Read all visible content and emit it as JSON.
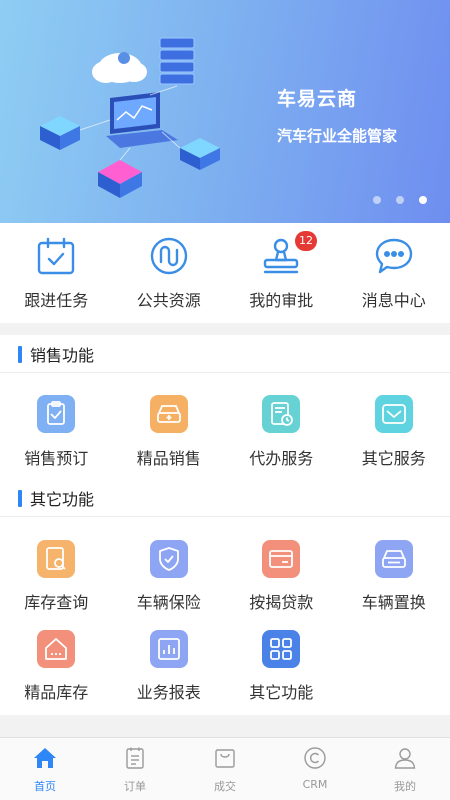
{
  "banner": {
    "title": "车易云商",
    "subtitle": "汽车行业全能管家",
    "dot_count": 3,
    "active_dot": 3
  },
  "quick_actions": [
    {
      "label": "跟进任务",
      "icon": "calendar-check-icon"
    },
    {
      "label": "公共资源",
      "icon": "route-circle-icon"
    },
    {
      "label": "我的审批",
      "icon": "stamp-icon",
      "badge": "12"
    },
    {
      "label": "消息中心",
      "icon": "chat-bubble-icon"
    }
  ],
  "sales": {
    "title": "销售功能",
    "items": [
      {
        "label": "销售预订",
        "icon": "clipboard-check-icon",
        "color": "#7fb0f4"
      },
      {
        "label": "精品销售",
        "icon": "car-plus-icon",
        "color": "#f5b064"
      },
      {
        "label": "代办服务",
        "icon": "document-clock-icon",
        "color": "#67d2d4"
      },
      {
        "label": "其它服务",
        "icon": "diamond-icon",
        "color": "#5fd3df"
      }
    ]
  },
  "other": {
    "title": "其它功能",
    "items": [
      {
        "label": "库存查询",
        "icon": "search-doc-icon",
        "color": "#f6b36b"
      },
      {
        "label": "车辆保险",
        "icon": "shield-check-icon",
        "color": "#8ea5f4"
      },
      {
        "label": "按揭贷款",
        "icon": "credit-card-icon",
        "color": "#f2907c"
      },
      {
        "label": "车辆置换",
        "icon": "car-swap-icon",
        "color": "#8ea5f4"
      },
      {
        "label": "精品库存",
        "icon": "house-icon",
        "color": "#f2907c"
      },
      {
        "label": "业务报表",
        "icon": "bar-report-icon",
        "color": "#8ea5f4"
      },
      {
        "label": "其它功能",
        "icon": "grid-icon",
        "color": "#4a82e8"
      }
    ]
  },
  "tabbar": {
    "active": 0,
    "items": [
      {
        "label": "首页",
        "icon": "home-icon"
      },
      {
        "label": "订单",
        "icon": "order-icon"
      },
      {
        "label": "成交",
        "icon": "bag-icon"
      },
      {
        "label": "CRM",
        "icon": "crm-icon"
      },
      {
        "label": "我的",
        "icon": "user-icon"
      }
    ]
  },
  "colors": {
    "accent": "#2f86f6",
    "icon_blue": "#3a8ee6",
    "badge": "#e53935"
  }
}
